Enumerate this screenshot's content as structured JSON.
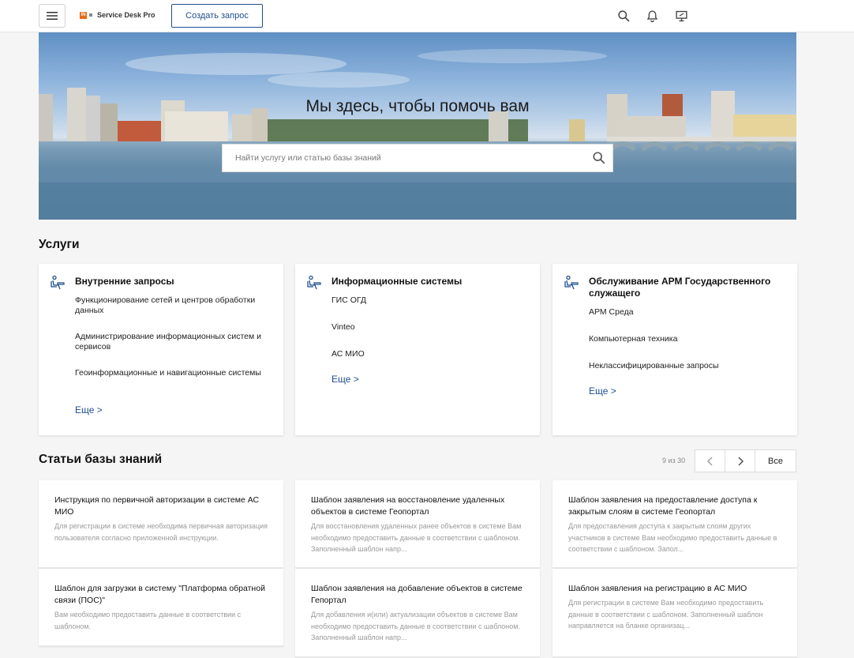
{
  "header": {
    "logo_badge": "IN",
    "logo_text": "Service Desk Pro",
    "create_button": "Создать запрос"
  },
  "hero": {
    "title": "Мы здесь, чтобы помочь вам",
    "search_placeholder": "Найти услугу или статью базы знаний"
  },
  "services": {
    "title": "Услуги",
    "more_label": "Еще >",
    "cards": [
      {
        "title": "Внутренние запросы",
        "items": [
          "Функционирование сетей и центров обработки данных",
          "Администрирование информационных систем и сервисов",
          "Геоинформационные и навигационные системы"
        ]
      },
      {
        "title": "Информационные системы",
        "items": [
          "ГИС ОГД",
          "Vinteo",
          "АС МИО"
        ]
      },
      {
        "title": "Обслуживание АРМ Государственного служащего",
        "items": [
          "АРМ Среда",
          "Компьютерная техника",
          "Неклассифицированные запросы"
        ]
      }
    ]
  },
  "knowledge": {
    "title": "Статьи базы знаний",
    "pager_count": "9 из 30",
    "all_label": "Все",
    "articles": [
      {
        "title": "Инструкция по первичной авторизации в системе АС МИО",
        "desc": "Для регистрации в системе необходима первичная авторизация пользователя согласно приложенной инструкции."
      },
      {
        "title": "Шаблон заявления на восстановление удаленных объектов в системе Геопортал",
        "desc": "Для восстановления удаленных ранее объектов в системе Вам необходимо предоставить данные в соответствии с шаблоном. Заполненный шаблон напр..."
      },
      {
        "title": "Шаблон заявления на предоставление доступа к закрытым слоям в системе Геопортал",
        "desc": "Для предоставления доступа к закрытым слоям других участников в системе Вам необходимо предоставить данные в соответствии с шаблоном. Запол..."
      },
      {
        "title": "Шаблон для загрузки в систему \"Платформа обратной связи (ПОС)\"",
        "desc": "Вам необходимо предоставить данные в соответствии с шаблоном."
      },
      {
        "title": "Шаблон заявления на добавление объектов в системе Гепортал",
        "desc": "Для добавления и(или) актуализации объектов в системе Вам необходимо предоставить данные в соответствии с шаблоном. Заполненный шаблон напр..."
      },
      {
        "title": "Шаблон заявления на регистрацию в АС МИО",
        "desc": "Для регистрации в системе Вам необходимо предоставить данные в соответствии с шаблоном. Заполненный шаблон направляется на бланке организац..."
      }
    ]
  },
  "colors": {
    "accent": "#1f4f8f",
    "logo": "#e96a12"
  },
  "icons": [
    "menu-icon",
    "search-icon",
    "bell-icon",
    "monitor-icon",
    "service-desk-icon",
    "chevron-left-icon",
    "chevron-right-icon"
  ]
}
